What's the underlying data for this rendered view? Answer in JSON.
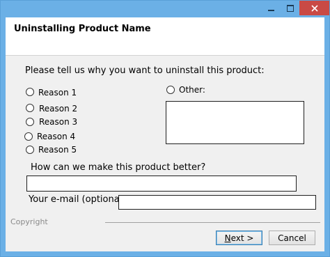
{
  "window": {
    "controls": {
      "minimize_icon": "minimize-icon",
      "maximize_icon": "maximize-icon",
      "close_icon": "close-icon"
    }
  },
  "header": {
    "title": "Uninstalling Product Name"
  },
  "form": {
    "prompt": "Please tell us why you want to uninstall this product:",
    "reasons": [
      "Reason 1",
      "Reason 2",
      "Reason 3",
      "Reason 4",
      "Reason 5"
    ],
    "other_label": "Other:",
    "other_value": "",
    "improve_label": "How can we make this product better?",
    "improve_value": "",
    "email_label": "Your e-mail (optional):",
    "email_value": ""
  },
  "footer": {
    "copyright": "Copyright",
    "next_mnemonic": "N",
    "next_rest": "ext >",
    "cancel_label": "Cancel"
  },
  "colors": {
    "titlebar": "#6bb0e6",
    "close_button": "#c94a45",
    "dialog_body": "#f0f0f0"
  }
}
